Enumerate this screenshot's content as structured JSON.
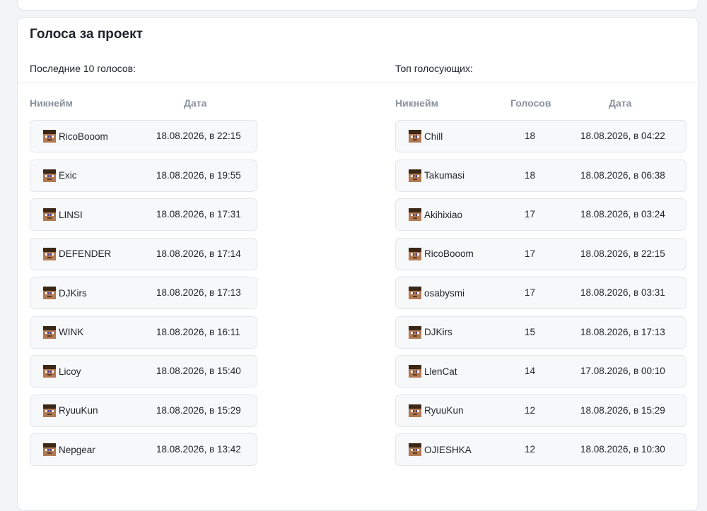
{
  "card": {
    "title": "Голоса за проект"
  },
  "last_votes": {
    "label": "Последние 10 голосов:",
    "headers": {
      "nick": "Никнейм",
      "date": "Дата"
    },
    "rows": [
      {
        "nick": "RicoBooom",
        "date": "18.08.2026, в 22:15"
      },
      {
        "nick": "Exic",
        "date": "18.08.2026, в 19:55"
      },
      {
        "nick": "LINSI",
        "date": "18.08.2026, в 17:31"
      },
      {
        "nick": "DEFENDER",
        "date": "18.08.2026, в 17:14"
      },
      {
        "nick": "DJKirs",
        "date": "18.08.2026, в 17:13"
      },
      {
        "nick": "WINK",
        "date": "18.08.2026, в 16:11"
      },
      {
        "nick": "Licoy",
        "date": "18.08.2026, в 15:40"
      },
      {
        "nick": "RyuuKun",
        "date": "18.08.2026, в 15:29"
      },
      {
        "nick": "Nepgear",
        "date": "18.08.2026, в 13:42"
      }
    ]
  },
  "top_voters": {
    "label": "Топ голосующих:",
    "headers": {
      "nick": "Никнейм",
      "votes": "Голосов",
      "date": "Дата"
    },
    "rows": [
      {
        "nick": "Chill",
        "votes": "18",
        "date": "18.08.2026, в 04:22"
      },
      {
        "nick": "Takumasi",
        "votes": "18",
        "date": "18.08.2026, в 06:38"
      },
      {
        "nick": "Akihixiao",
        "votes": "17",
        "date": "18.08.2026, в 03:24"
      },
      {
        "nick": "RicoBooom",
        "votes": "17",
        "date": "18.08.2026, в 22:15"
      },
      {
        "nick": "osabysmi",
        "votes": "17",
        "date": "18.08.2026, в 03:31"
      },
      {
        "nick": "DJKirs",
        "votes": "15",
        "date": "18.08.2026, в 17:13"
      },
      {
        "nick": "LlenCat",
        "votes": "14",
        "date": "17.08.2026, в 00:10"
      },
      {
        "nick": "RyuuKun",
        "votes": "12",
        "date": "18.08.2026, в 15:29"
      },
      {
        "nick": "OJIESHKA",
        "votes": "12",
        "date": "18.08.2026, в 10:30"
      }
    ]
  },
  "icons": {
    "avatar": "minecraft-steve-head-icon"
  }
}
